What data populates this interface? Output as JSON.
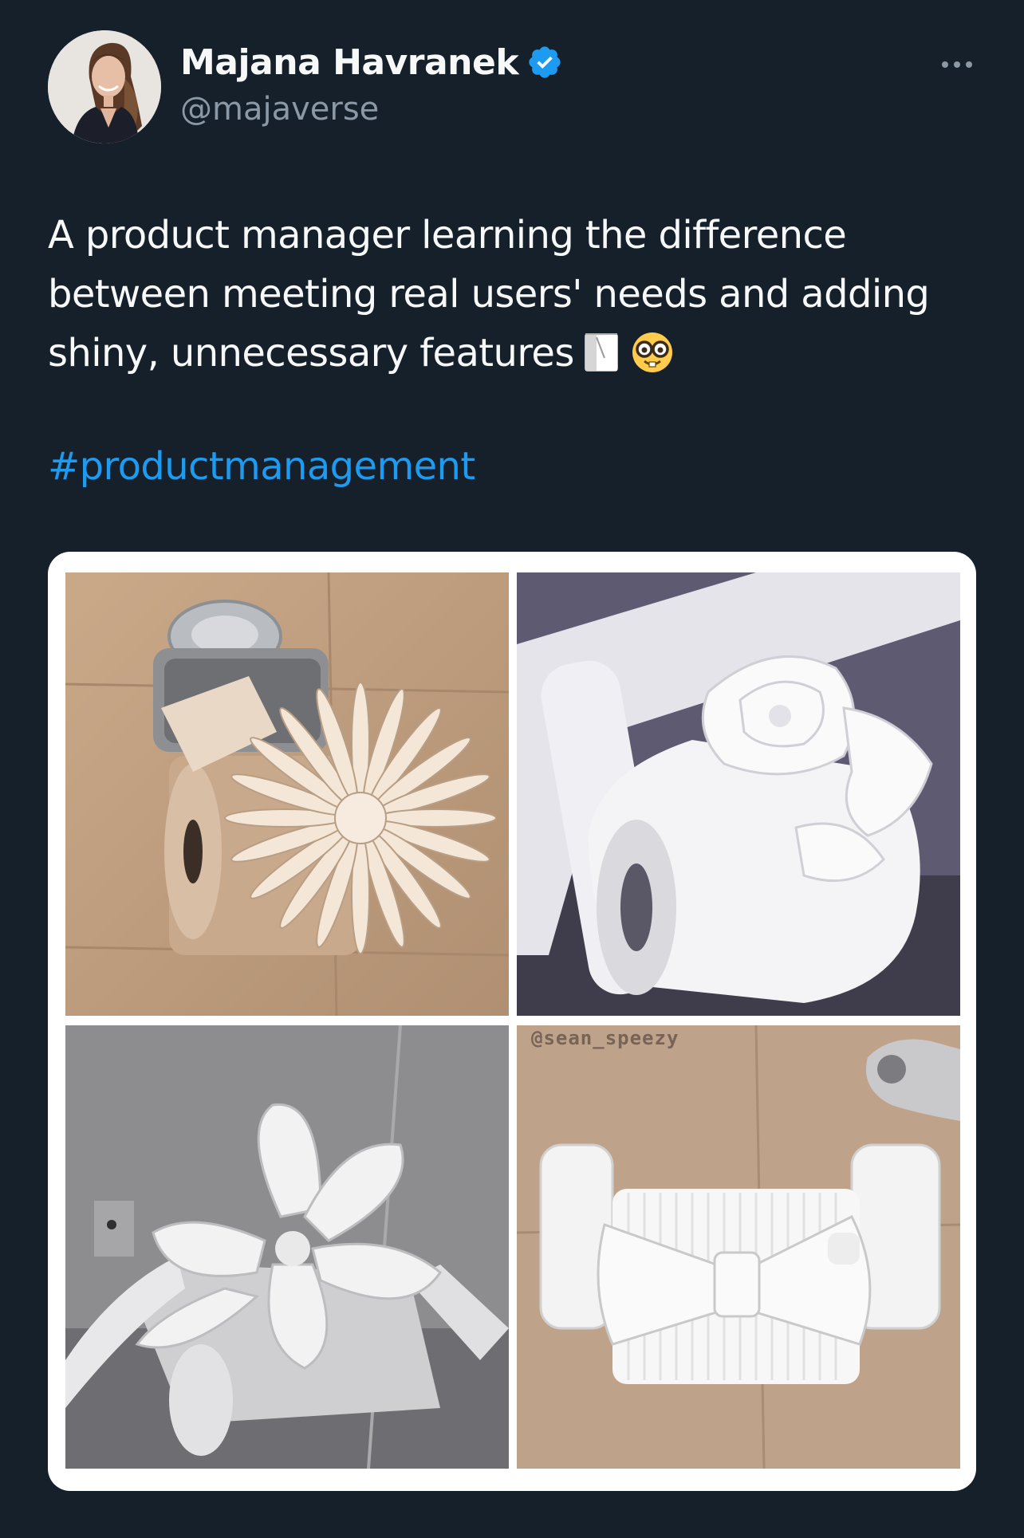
{
  "author": {
    "display_name": "Majana Havranek",
    "handle": "@majaverse",
    "verified": true,
    "verified_color": "#1d9bf0"
  },
  "tweet": {
    "text": "A product manager learning the difference between meeting real users' needs and adding shiny, unnecessary features",
    "emojis": [
      "toilet-paper-roll-emoji",
      "nerd-face-emoji"
    ],
    "hashtag": "#productmanagement"
  },
  "media": {
    "photos": [
      {
        "subject": "toilet-paper-daisy-fold"
      },
      {
        "subject": "toilet-paper-rose-fold"
      },
      {
        "subject": "toilet-paper-flower-fold"
      },
      {
        "subject": "toilet-paper-bow-fold"
      }
    ],
    "watermark": "@sean_speezy"
  },
  "colors": {
    "background": "#15202b",
    "text_primary": "#f7f9f9",
    "text_secondary": "#8b98a5",
    "link": "#1d9bf0"
  },
  "icons": {
    "more": "more-dots-icon",
    "verified": "verified-badge-icon"
  }
}
